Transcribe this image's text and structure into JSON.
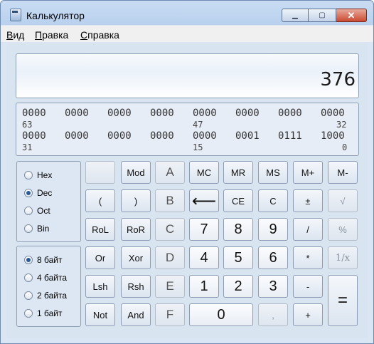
{
  "window": {
    "title": "Калькулятор"
  },
  "menu": [
    {
      "label": "Вид",
      "underline": "В",
      "rest": "ид"
    },
    {
      "label": "Правка",
      "underline": "П",
      "rest": "равка"
    },
    {
      "label": "Справка",
      "underline": "С",
      "rest": "правка"
    }
  ],
  "display": {
    "value": "376"
  },
  "bits": {
    "row1": [
      "0000",
      "0000",
      "0000",
      "0000",
      "0000",
      "0000",
      "0000",
      "0000"
    ],
    "row1_idx": [
      "63",
      "47",
      "32"
    ],
    "row2": [
      "0000",
      "0000",
      "0000",
      "0000",
      "0000",
      "0001",
      "0111",
      "1000"
    ],
    "row2_idx": [
      "31",
      "15",
      "0"
    ]
  },
  "radix": {
    "options": [
      "Hex",
      "Dec",
      "Oct",
      "Bin"
    ],
    "selected": "Dec"
  },
  "word_size": {
    "options": [
      "8 байт",
      "4 байта",
      "2 байта",
      "1 байт"
    ],
    "selected": "8 байт"
  },
  "buttons": {
    "blank": "",
    "mod": "Mod",
    "a": "A",
    "mc": "MC",
    "mr": "MR",
    "ms": "MS",
    "mplus": "M+",
    "mminus": "M-",
    "lparen": "(",
    "rparen": ")",
    "b": "B",
    "backspace": "⟵",
    "ce": "CE",
    "c": "C",
    "plusminus": "±",
    "sqrt": "√",
    "rol": "RoL",
    "ror": "RoR",
    "cc": "C",
    "d7": "7",
    "d8": "8",
    "d9": "9",
    "div": "/",
    "pct": "%",
    "or": "Or",
    "xor": "Xor",
    "d": "D",
    "d4": "4",
    "d5": "5",
    "d6": "6",
    "mul": "*",
    "recip": "1/x",
    "lsh": "Lsh",
    "rsh": "Rsh",
    "e": "E",
    "d1": "1",
    "d2": "2",
    "d3": "3",
    "minus": "-",
    "equals": "=",
    "not": "Not",
    "and": "And",
    "f": "F",
    "d0": "0",
    "dot": ",",
    "plus": "+"
  }
}
